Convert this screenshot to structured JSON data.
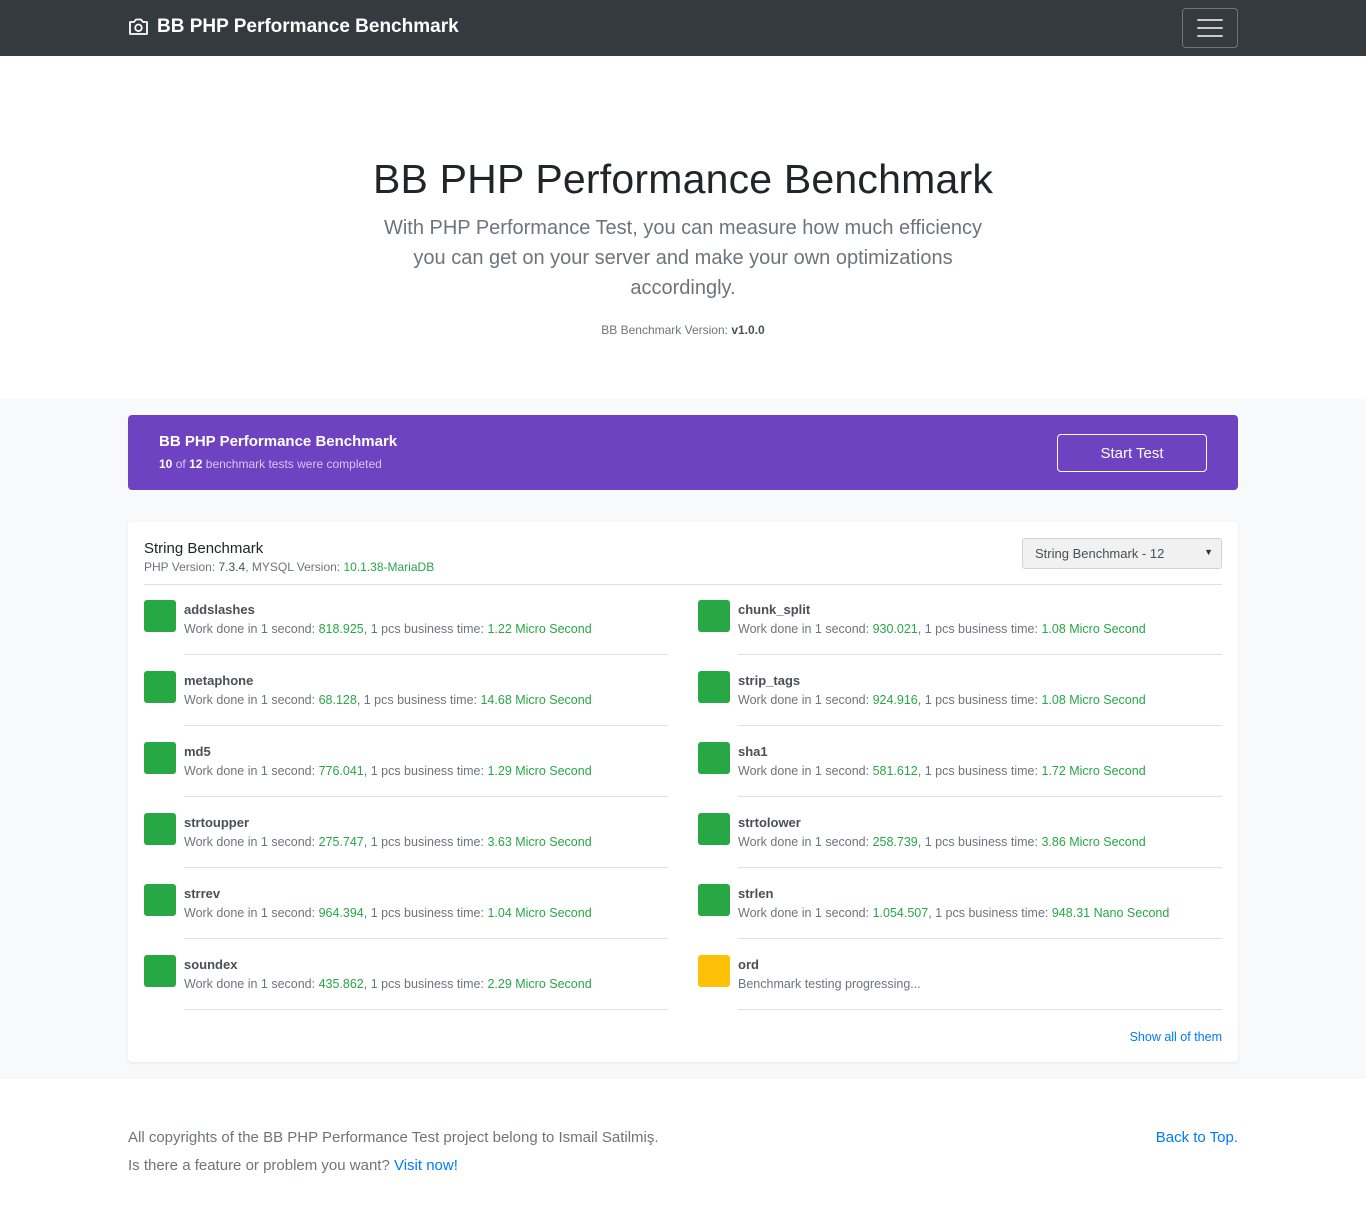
{
  "navbar": {
    "brand": "BB PHP Performance Benchmark",
    "brand_icon": "camera-icon",
    "toggler_icon": "hamburger-menu-icon"
  },
  "hero": {
    "title": "BB PHP Performance Benchmark",
    "lead": "With PHP Performance Test, you can measure how much efficiency you can get on your server and make your own optimizations accordingly.",
    "version_label": "BB Benchmark Version:",
    "version_value": "v1.0.0"
  },
  "banner": {
    "title": "BB PHP Performance Benchmark",
    "completed": "10",
    "of_text": "of",
    "total": "12",
    "suffix": "benchmark tests were completed",
    "button": "Start Test"
  },
  "card": {
    "title": "String Benchmark",
    "php_label": "PHP Version:",
    "php_value": "7.3.4",
    "mysql_label": ", MYSQL Version:",
    "mysql_value": "10.1.38-MariaDB",
    "select_value": "String Benchmark - 12",
    "show_all": "Show all of them",
    "items": [
      {
        "name": "addslashes",
        "status": "done",
        "ops": "818.925",
        "time": "1.22 Micro Second"
      },
      {
        "name": "chunk_split",
        "status": "done",
        "ops": "930.021",
        "time": "1.08 Micro Second"
      },
      {
        "name": "metaphone",
        "status": "done",
        "ops": "68.128",
        "time": "14.68 Micro Second"
      },
      {
        "name": "strip_tags",
        "status": "done",
        "ops": "924.916",
        "time": "1.08 Micro Second"
      },
      {
        "name": "md5",
        "status": "done",
        "ops": "776.041",
        "time": "1.29 Micro Second"
      },
      {
        "name": "sha1",
        "status": "done",
        "ops": "581.612",
        "time": "1.72 Micro Second"
      },
      {
        "name": "strtoupper",
        "status": "done",
        "ops": "275.747",
        "time": "3.63 Micro Second"
      },
      {
        "name": "strtolower",
        "status": "done",
        "ops": "258.739",
        "time": "3.86 Micro Second"
      },
      {
        "name": "strrev",
        "status": "done",
        "ops": "964.394",
        "time": "1.04 Micro Second"
      },
      {
        "name": "strlen",
        "status": "done",
        "ops": "1.054.507",
        "time": "948.31 Nano Second"
      },
      {
        "name": "soundex",
        "status": "done",
        "ops": "435.862",
        "time": "2.29 Micro Second"
      },
      {
        "name": "ord",
        "status": "progress",
        "progress_text": "Benchmark testing progressing..."
      }
    ],
    "labels": {
      "work_prefix": "Work done in 1 second: ",
      "business": ", 1 pcs business time: "
    }
  },
  "footer": {
    "copyright": "All copyrights of the BB PHP Performance Test project belong to Ismail Satilmiş.",
    "question": "Is there a feature or problem you want?",
    "visit_link": "Visit now!",
    "back_to_top": "Back to Top."
  },
  "colors": {
    "navbar": "#343a40",
    "banner": "#6f42c1",
    "success": "#28a745",
    "warning": "#ffc107",
    "link": "#007bff"
  }
}
